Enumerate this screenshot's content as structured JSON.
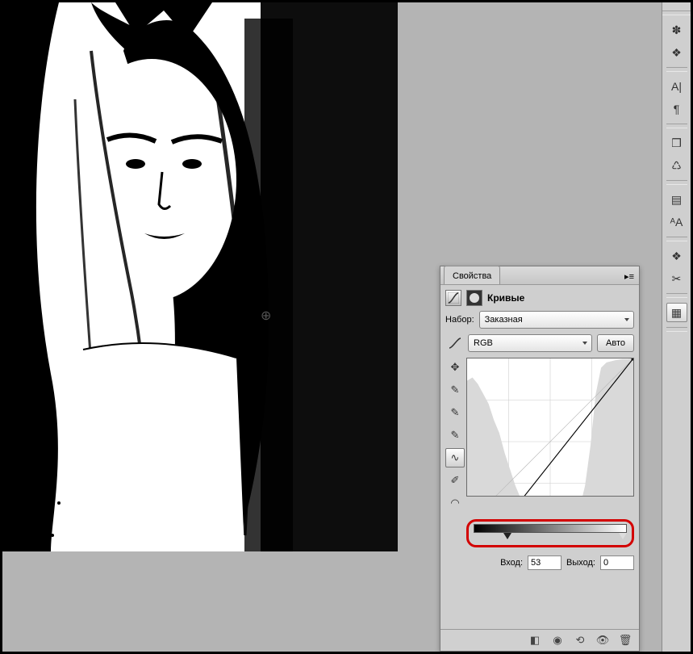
{
  "panel": {
    "tab_label": "Свойства",
    "title": "Кривые",
    "preset_label": "Набор:",
    "preset_value": "Заказная",
    "channel_value": "RGB",
    "auto_button": "Авто",
    "input_label": "Вход:",
    "input_value": "53",
    "output_label": "Выход:",
    "output_value": "0"
  },
  "toolbar": {
    "icons": [
      {
        "name": "brushes-icon",
        "glyph": "✽"
      },
      {
        "name": "swatches-icon",
        "glyph": "❖"
      },
      {
        "name": "character-icon",
        "glyph": "A|"
      },
      {
        "name": "paragraph-icon",
        "glyph": "¶"
      },
      {
        "name": "3d-icon",
        "glyph": "❒"
      },
      {
        "name": "clone-source-icon",
        "glyph": "♺"
      },
      {
        "name": "layer-comps-icon",
        "glyph": "▤"
      },
      {
        "name": "char-styles-icon",
        "glyph": "ᴬA"
      },
      {
        "name": "layers-icon",
        "glyph": "❖"
      },
      {
        "name": "adjustments-icon",
        "glyph": "✂"
      },
      {
        "name": "properties-icon",
        "glyph": "▦",
        "selected": true
      }
    ]
  },
  "curve_tools": {
    "items": [
      {
        "name": "target-tool-icon",
        "glyph": "✥"
      },
      {
        "name": "black-point-icon",
        "glyph": "✎"
      },
      {
        "name": "gray-point-icon",
        "glyph": "✎"
      },
      {
        "name": "white-point-icon",
        "glyph": "✎"
      },
      {
        "name": "curve-tool-icon",
        "glyph": "∿",
        "selected": true
      },
      {
        "name": "pencil-tool-icon",
        "glyph": "✐"
      },
      {
        "name": "smooth-tool-icon",
        "glyph": "◠"
      }
    ]
  },
  "footer": {
    "icons": [
      {
        "name": "clip-layer-icon",
        "glyph": "◧"
      },
      {
        "name": "view-previous-icon",
        "glyph": "◉"
      },
      {
        "name": "reset-icon",
        "glyph": "⟲"
      },
      {
        "name": "visibility-icon",
        "glyph": "👁"
      },
      {
        "name": "delete-icon",
        "glyph": "🗑"
      }
    ]
  },
  "chart_data": {
    "type": "line",
    "title": "Кривые RGB",
    "xlabel": "Вход",
    "ylabel": "Выход",
    "xlim": [
      0,
      255
    ],
    "ylim": [
      0,
      255
    ],
    "curve_points": [
      {
        "x": 53,
        "y": 0
      },
      {
        "x": 255,
        "y": 255
      }
    ],
    "histogram_bins": [
      220,
      225,
      215,
      200,
      185,
      160,
      140,
      110,
      85,
      60,
      40,
      25,
      15,
      8,
      5,
      3,
      3,
      3,
      3,
      5,
      10,
      25,
      60,
      120,
      200,
      240,
      248,
      250,
      252,
      253,
      253,
      254
    ]
  }
}
